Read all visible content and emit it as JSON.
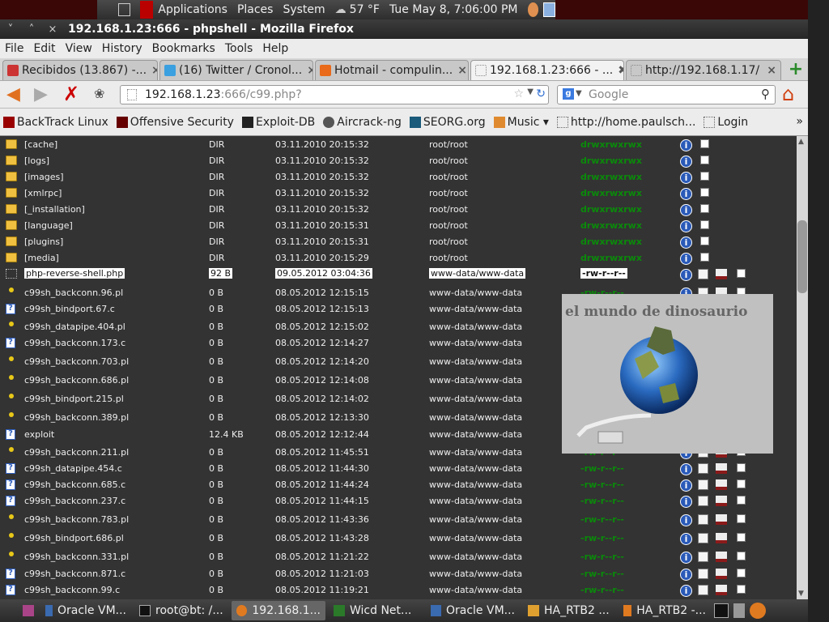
{
  "panel": {
    "applications": "Applications",
    "places": "Places",
    "system": "System",
    "weather": "57 °F",
    "clock": "Tue May  8,  7:06:00 PM"
  },
  "window": {
    "title": "192.168.1.23:666 - phpshell - Mozilla Firefox",
    "btn_min": "˅",
    "btn_max": "˄",
    "btn_close": "×"
  },
  "menu": [
    "File",
    "Edit",
    "View",
    "History",
    "Bookmarks",
    "Tools",
    "Help"
  ],
  "tabs": [
    {
      "label": "Recibidos (13.867) -...",
      "active": false
    },
    {
      "label": "(16) Twitter / Cronol...",
      "active": false
    },
    {
      "label": "Hotmail - compulin...",
      "active": false
    },
    {
      "label": "192.168.1.23:666 - ...",
      "active": true
    },
    {
      "label": "http://192.168.1.17/",
      "active": false
    }
  ],
  "nav": {
    "url_host": "192.168.1.23",
    "url_rest": ":666/c99.php?",
    "search_placeholder": "Google"
  },
  "bookmarks": [
    "BackTrack Linux",
    "Offensive Security",
    "Exploit-DB",
    "Aircrack-ng",
    "SEORG.org",
    "Music ▾",
    "http://home.paulsch...",
    "Login"
  ],
  "bookmarks_more": "»",
  "files": [
    {
      "name": "[cache]",
      "size": "DIR",
      "date": "03.11.2010 20:15:32",
      "owner": "root/root",
      "perms": "drwxrwxrwx",
      "icon": "folder"
    },
    {
      "name": "[logs]",
      "size": "DIR",
      "date": "03.11.2010 20:15:32",
      "owner": "root/root",
      "perms": "drwxrwxrwx",
      "icon": "folder"
    },
    {
      "name": "[images]",
      "size": "DIR",
      "date": "03.11.2010 20:15:32",
      "owner": "root/root",
      "perms": "drwxrwxrwx",
      "icon": "folder"
    },
    {
      "name": "[xmlrpc]",
      "size": "DIR",
      "date": "03.11.2010 20:15:32",
      "owner": "root/root",
      "perms": "drwxrwxrwx",
      "icon": "folder"
    },
    {
      "name": "[_installation]",
      "size": "DIR",
      "date": "03.11.2010 20:15:32",
      "owner": "root/root",
      "perms": "drwxrwxrwx",
      "icon": "folder"
    },
    {
      "name": "[language]",
      "size": "DIR",
      "date": "03.11.2010 20:15:31",
      "owner": "root/root",
      "perms": "drwxrwxrwx",
      "icon": "folder"
    },
    {
      "name": "[plugins]",
      "size": "DIR",
      "date": "03.11.2010 20:15:31",
      "owner": "root/root",
      "perms": "drwxrwxrwx",
      "icon": "folder"
    },
    {
      "name": "[media]",
      "size": "DIR",
      "date": "03.11.2010 20:15:29",
      "owner": "root/root",
      "perms": "drwxrwxrwx",
      "icon": "folder"
    },
    {
      "name": "php-reverse-shell.php",
      "size": "92 B",
      "date": "09.05.2012 03:04:36",
      "owner": "www-data/www-data",
      "perms": "-rw-r--r--",
      "icon": "php",
      "highlight": true
    },
    {
      "name": "c99sh_backconn.96.pl",
      "size": "0 B",
      "date": "08.05.2012 12:15:15",
      "owner": "www-data/www-data",
      "perms": "-rw-r--r--",
      "icon": "dot"
    },
    {
      "name": "c99sh_bindport.67.c",
      "size": "0 B",
      "date": "08.05.2012 12:15:13",
      "owner": "www-data/www-data",
      "perms": "-rw-r--r--",
      "icon": "q"
    },
    {
      "name": "c99sh_datapipe.404.pl",
      "size": "0 B",
      "date": "08.05.2012 12:15:02",
      "owner": "www-data/www-data",
      "perms": "-rw-r--r--",
      "icon": "dot"
    },
    {
      "name": "c99sh_backconn.173.c",
      "size": "0 B",
      "date": "08.05.2012 12:14:27",
      "owner": "www-data/www-data",
      "perms": "-rw-r--r--",
      "icon": "q"
    },
    {
      "name": "c99sh_backconn.703.pl",
      "size": "0 B",
      "date": "08.05.2012 12:14:20",
      "owner": "www-data/www-data",
      "perms": "-rw-r--r--",
      "icon": "dot"
    },
    {
      "name": "c99sh_backconn.686.pl",
      "size": "0 B",
      "date": "08.05.2012 12:14:08",
      "owner": "www-data/www-data",
      "perms": "-rw-r--r--",
      "icon": "dot"
    },
    {
      "name": "c99sh_bindport.215.pl",
      "size": "0 B",
      "date": "08.05.2012 12:14:02",
      "owner": "www-data/www-data",
      "perms": "-rw-r--r--",
      "icon": "dot"
    },
    {
      "name": "c99sh_backconn.389.pl",
      "size": "0 B",
      "date": "08.05.2012 12:13:30",
      "owner": "www-data/www-data",
      "perms": "-rw-r--r--",
      "icon": "dot"
    },
    {
      "name": "exploit",
      "size": "12.4 KB",
      "date": "08.05.2012 12:12:44",
      "owner": "www-data/www-data",
      "perms": "-rw-r--r--",
      "icon": "q"
    },
    {
      "name": "c99sh_backconn.211.pl",
      "size": "0 B",
      "date": "08.05.2012 11:45:51",
      "owner": "www-data/www-data",
      "perms": "-rw-r--r--",
      "icon": "dot"
    },
    {
      "name": "c99sh_datapipe.454.c",
      "size": "0 B",
      "date": "08.05.2012 11:44:30",
      "owner": "www-data/www-data",
      "perms": "-rw-r--r--",
      "icon": "q"
    },
    {
      "name": "c99sh_backconn.685.c",
      "size": "0 B",
      "date": "08.05.2012 11:44:24",
      "owner": "www-data/www-data",
      "perms": "-rw-r--r--",
      "icon": "q"
    },
    {
      "name": "c99sh_backconn.237.c",
      "size": "0 B",
      "date": "08.05.2012 11:44:15",
      "owner": "www-data/www-data",
      "perms": "-rw-r--r--",
      "icon": "q"
    },
    {
      "name": "c99sh_backconn.783.pl",
      "size": "0 B",
      "date": "08.05.2012 11:43:36",
      "owner": "www-data/www-data",
      "perms": "-rw-r--r--",
      "icon": "dot"
    },
    {
      "name": "c99sh_bindport.686.pl",
      "size": "0 B",
      "date": "08.05.2012 11:43:28",
      "owner": "www-data/www-data",
      "perms": "-rw-r--r--",
      "icon": "dot"
    },
    {
      "name": "c99sh_backconn.331.pl",
      "size": "0 B",
      "date": "08.05.2012 11:21:22",
      "owner": "www-data/www-data",
      "perms": "-rw-r--r--",
      "icon": "dot"
    },
    {
      "name": "c99sh_backconn.871.c",
      "size": "0 B",
      "date": "08.05.2012 11:21:03",
      "owner": "www-data/www-data",
      "perms": "-rw-r--r--",
      "icon": "q"
    },
    {
      "name": "c99sh_backconn.99.c",
      "size": "0 B",
      "date": "08.05.2012 11:19:21",
      "owner": "www-data/www-data",
      "perms": "-rw-r--r--",
      "icon": "q"
    }
  ],
  "popup": {
    "title": "el mundo de dinosaurio"
  },
  "taskbar": [
    {
      "label": "Oracle VM...",
      "active": false
    },
    {
      "label": "root@bt: /...",
      "active": false
    },
    {
      "label": "192.168.1...",
      "active": true
    },
    {
      "label": "Wicd Net...",
      "active": false
    },
    {
      "label": "Oracle VM...",
      "active": false
    },
    {
      "label": "HA_RTB2 ...",
      "active": false
    },
    {
      "label": "HA_RTB2 -...",
      "active": false
    }
  ],
  "colors": {
    "perm_green": "#0a8a0a",
    "panel_red": "#3a0606",
    "content_bg": "#333333"
  }
}
